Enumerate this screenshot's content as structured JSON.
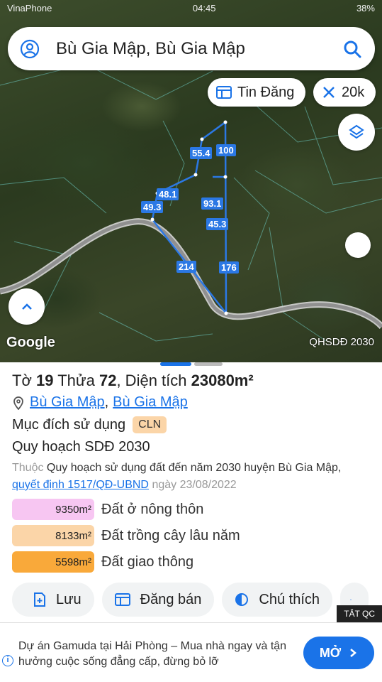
{
  "status": {
    "carrier": "VinaPhone",
    "time": "04:45",
    "battery": "38%"
  },
  "search": {
    "text": "Bù Gia Mập, Bù Gia Mập"
  },
  "map": {
    "tin_dang_label": "Tin Đăng",
    "radius_label": "20k",
    "google_label": "Google",
    "layer_label": "QHSDĐ 2030",
    "edge_labels": [
      "55.4",
      "100",
      "48.1",
      "49.3",
      "93.1",
      "45.3",
      "214",
      "176"
    ]
  },
  "parcel": {
    "title_prefix": "Tờ",
    "sheet_no": "19",
    "parcel_word": "Thửa",
    "parcel_no": "72",
    "area_label": ", Diện tích",
    "area_value": "23080m²",
    "location_1": "Bù Gia Mập",
    "location_sep": ",",
    "location_2": "Bù Gia Mập",
    "usage_label": "Mục đích sử dụng",
    "usage_code": "CLN",
    "plan_title": "Quy hoạch SDĐ 2030",
    "plan_desc_prefix": "Thuộc",
    "plan_desc_name": "Quy hoạch sử dụng đất đến năm 2030 huyện Bù Gia Mập,",
    "plan_decision": "quyết định 1517/QĐ-UBND",
    "plan_date": "ngày 23/08/2022",
    "legend": [
      {
        "value": "9350m²",
        "name": "Đất ở nông thôn",
        "color": "#f7c6f2"
      },
      {
        "value": "8133m²",
        "name": "Đất trồng cây lâu năm",
        "color": "#fbd5a8"
      },
      {
        "value": "5598m²",
        "name": "Đất giao thông",
        "color": "#f9a93a"
      }
    ]
  },
  "actions": {
    "save": "Lưu",
    "post_sale": "Đăng bán",
    "legend": "Chú thích"
  },
  "ad": {
    "close_label": "TẮT QC",
    "text": "Dự án Gamuda tại Hải Phòng – Mua nhà ngay và tận hưởng cuộc sống đẳng cấp, đừng bỏ lỡ",
    "cta": "MỞ"
  }
}
